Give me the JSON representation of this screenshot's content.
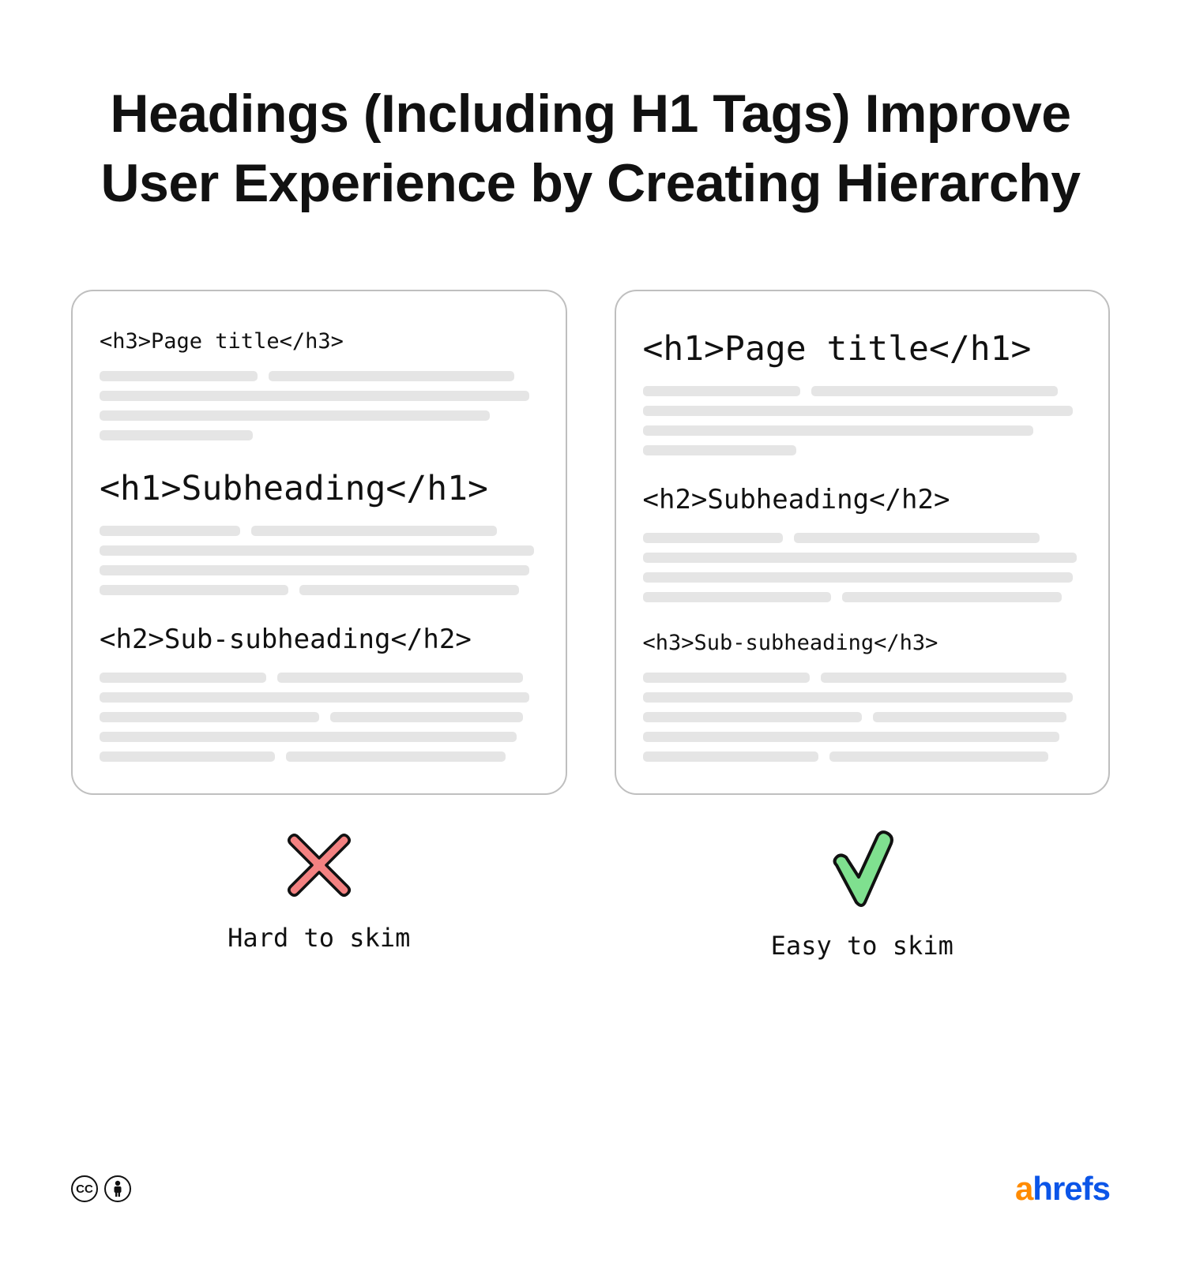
{
  "title": "Headings (Including H1 Tags) Improve User Experience by Creating Hierarchy",
  "cards": {
    "bad": {
      "sections": [
        {
          "code": "<h3>Page title</h3>",
          "size": "sm"
        },
        {
          "code": "<h1>Subheading</h1>",
          "size": "lg"
        },
        {
          "code": "<h2>Sub-subheading</h2>",
          "size": "md"
        }
      ],
      "verdict_label": "Hard to skim"
    },
    "good": {
      "sections": [
        {
          "code": "<h1>Page title</h1>",
          "size": "lg"
        },
        {
          "code": "<h2>Subheading</h2>",
          "size": "md"
        },
        {
          "code": "<h3>Sub-subheading</h3>",
          "size": "sm"
        }
      ],
      "verdict_label": "Easy to skim"
    }
  },
  "bar_patterns": [
    [
      36,
      56,
      98,
      89,
      35
    ],
    [
      32,
      56,
      99,
      98,
      43,
      50
    ],
    [
      38,
      56,
      98,
      50,
      44,
      95,
      40,
      50
    ]
  ],
  "colors": {
    "cross_fill": "#F38181",
    "cross_stroke": "#111",
    "check_fill": "#7FE08F",
    "check_stroke": "#111",
    "bar": "#E5E5E5",
    "card_border": "#bfbfbf"
  },
  "brand": {
    "first": "a",
    "rest": "hrefs"
  },
  "license": {
    "cc": "cc",
    "by": "by"
  }
}
